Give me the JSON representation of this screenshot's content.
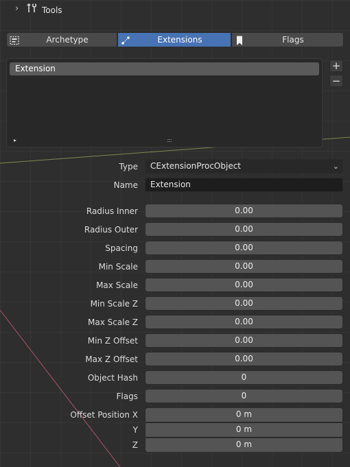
{
  "header": {
    "title": "Tools"
  },
  "tabs": [
    {
      "label": "Archetype",
      "icon": "archetype-icon",
      "active": false
    },
    {
      "label": "Extensions",
      "icon": "extensions-icon",
      "active": true
    },
    {
      "label": "Flags",
      "icon": "bookmark-icon",
      "active": false
    }
  ],
  "extension_list": {
    "items": [
      "Extension"
    ],
    "add_label": "+",
    "remove_label": "−",
    "play_glyph": "▸",
    "grip_glyph": "::::"
  },
  "type_field": {
    "label": "Type",
    "value": "CExtensionProcObject"
  },
  "name_field": {
    "label": "Name",
    "value": "Extension"
  },
  "properties": [
    {
      "label": "Radius Inner",
      "value": "0.00"
    },
    {
      "label": "Radius Outer",
      "value": "0.00"
    },
    {
      "label": "Spacing",
      "value": "0.00"
    },
    {
      "label": "Min Scale",
      "value": "0.00"
    },
    {
      "label": "Max Scale",
      "value": "0.00"
    },
    {
      "label": "Min Scale Z",
      "value": "0.00"
    },
    {
      "label": "Max Scale Z",
      "value": "0.00"
    },
    {
      "label": "Min Z Offset",
      "value": "0.00"
    },
    {
      "label": "Max Z Offset",
      "value": "0.00"
    },
    {
      "label": "Object Hash",
      "value": "0"
    },
    {
      "label": "Flags",
      "value": "0"
    }
  ],
  "offset_position": [
    {
      "label": "Offset Position X",
      "value": "0 m"
    },
    {
      "label": "Y",
      "value": "0 m"
    },
    {
      "label": "Z",
      "value": "0 m"
    }
  ],
  "colors": {
    "accent": "#4772b3",
    "panel_bg": "#2e2e2e",
    "field_bg": "#545454",
    "x_axis_line": "#b06070",
    "y_axis_line": "#8a9a50"
  }
}
